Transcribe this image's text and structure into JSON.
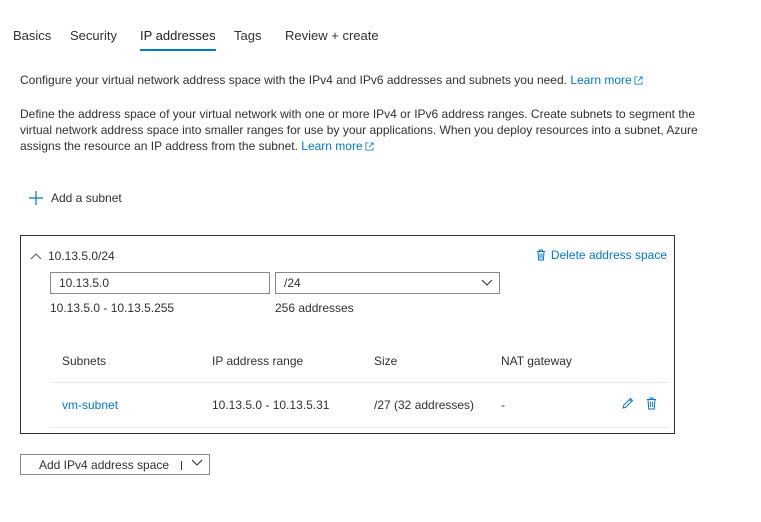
{
  "tabs": [
    {
      "label": "Basics",
      "active": false
    },
    {
      "label": "Security",
      "active": false
    },
    {
      "label": "IP addresses",
      "active": true
    },
    {
      "label": "Tags",
      "active": false
    },
    {
      "label": "Review + create",
      "active": false
    }
  ],
  "intro": {
    "text": "Configure your virtual network address space with the IPv4 and IPv6 addresses and subnets you need.",
    "link": "Learn more"
  },
  "description": {
    "text": "Define the address space of your virtual network with one or more IPv4 or IPv6 address ranges. Create subnets to segment the virtual network address space into smaller ranges for use by your applications. When you deploy resources into a subnet, Azure assigns the resource an IP address from the subnet.",
    "link": "Learn more"
  },
  "add_subnet_label": "Add a subnet",
  "address_space": {
    "title": "10.13.5.0/24",
    "delete_label": "Delete address space",
    "ip_value": "10.13.5.0",
    "prefix_value": "/24",
    "range_text": "10.13.5.0 - 10.13.5.255",
    "count_text": "256 addresses",
    "table": {
      "headers": [
        "Subnets",
        "IP address range",
        "Size",
        "NAT gateway"
      ],
      "rows": [
        {
          "subnet": "vm-subnet",
          "range": "10.13.5.0 - 10.13.5.31",
          "size": "/27 (32 addresses)",
          "nat": "-"
        }
      ]
    }
  },
  "add_ipv4_label": "Add IPv4 address space",
  "colors": {
    "accent": "#0078d4",
    "text": "#323130",
    "border": "#8a8886"
  }
}
